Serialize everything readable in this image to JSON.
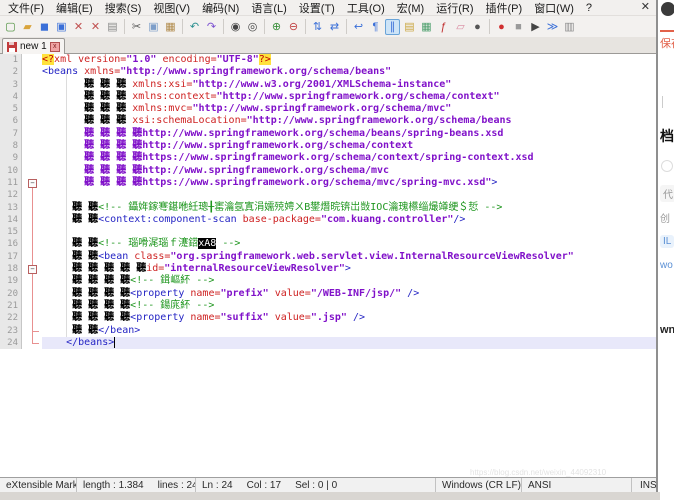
{
  "window": {
    "close_glyph": "✕"
  },
  "menu": {
    "items": [
      "文件(F)",
      "编辑(E)",
      "搜索(S)",
      "视图(V)",
      "编码(N)",
      "语言(L)",
      "设置(T)",
      "工具(O)",
      "宏(M)",
      "运行(R)",
      "插件(P)",
      "窗口(W)",
      "?"
    ]
  },
  "toolbar": {
    "buttons": [
      {
        "name": "new-file-icon",
        "glyph": "▢",
        "color": "#4a8f3a"
      },
      {
        "name": "open-folder-icon",
        "glyph": "▰",
        "color": "#d9a43c"
      },
      {
        "name": "save-icon",
        "glyph": "◼",
        "color": "#3a6fd8"
      },
      {
        "name": "save-all-icon",
        "glyph": "▣",
        "color": "#3a6fd8"
      },
      {
        "name": "close-doc-icon",
        "glyph": "✕",
        "color": "#c05050"
      },
      {
        "name": "close-all-docs-icon",
        "glyph": "✕",
        "color": "#c05050"
      },
      {
        "name": "print-icon",
        "glyph": "▤",
        "color": "#8a8a8a"
      },
      {
        "name": "cut-icon",
        "glyph": "✂",
        "color": "#555555",
        "sep": true
      },
      {
        "name": "copy-icon",
        "glyph": "▣",
        "color": "#7d9ec9"
      },
      {
        "name": "paste-icon",
        "glyph": "▦",
        "color": "#b08a4a"
      },
      {
        "name": "undo-icon",
        "glyph": "↶",
        "color": "#2a8f8f",
        "sep": true
      },
      {
        "name": "redo-icon",
        "glyph": "↷",
        "color": "#7a4fd0"
      },
      {
        "name": "find-icon",
        "glyph": "◉",
        "color": "#444444",
        "sep": true
      },
      {
        "name": "replace-icon",
        "glyph": "◎",
        "color": "#444444"
      },
      {
        "name": "zoom-in-icon",
        "glyph": "⊕",
        "color": "#3a8f3a",
        "sep": true
      },
      {
        "name": "zoom-out-icon",
        "glyph": "⊖",
        "color": "#c04040"
      },
      {
        "name": "sync-vertical-scroll-icon",
        "glyph": "⇅",
        "color": "#3a6fd8",
        "sep": true
      },
      {
        "name": "sync-horizontal-scroll-icon",
        "glyph": "⇄",
        "color": "#3a6fd8"
      },
      {
        "name": "word-wrap-icon",
        "glyph": "↩",
        "color": "#3a6fd8",
        "sep": true
      },
      {
        "name": "show-all-chars-icon",
        "glyph": "¶",
        "color": "#3a6fd8"
      },
      {
        "name": "indent-guide-icon",
        "glyph": "∥",
        "color": "#3a6fd8",
        "pressed": true
      },
      {
        "name": "user-defined-language-icon",
        "glyph": "▤",
        "color": "#c9a53c"
      },
      {
        "name": "doc-map-icon",
        "glyph": "▦",
        "color": "#4a9e6a"
      },
      {
        "name": "function-list-icon",
        "glyph": "ƒ",
        "color": "#c03030"
      },
      {
        "name": "folder-workspace-icon",
        "glyph": "▱",
        "color": "#d98aa0"
      },
      {
        "name": "monitoring-icon",
        "glyph": "●",
        "color": "#555555"
      },
      {
        "name": "macro-record-icon",
        "glyph": "●",
        "color": "#d03030",
        "sep": true
      },
      {
        "name": "macro-stop-icon",
        "glyph": "■",
        "color": "#9a9a9a"
      },
      {
        "name": "macro-play-icon",
        "glyph": "▶",
        "color": "#444444"
      },
      {
        "name": "macro-run-multiple-icon",
        "glyph": "≫",
        "color": "#3a6fd8"
      },
      {
        "name": "macro-save-icon",
        "glyph": "▥",
        "color": "#8a8a8a"
      }
    ]
  },
  "tab": {
    "title": "new 1",
    "close_glyph": "x"
  },
  "editor": {
    "caret_line": 24,
    "fold": {
      "header_lines": [
        11,
        18
      ],
      "tee_lines": [
        23
      ],
      "corner_lines": [
        24
      ],
      "vline_ranges": [
        [
          12,
          17
        ],
        [
          19,
          22
        ]
      ]
    },
    "lines": [
      {
        "n": 1,
        "segs": [
          [
            "decl",
            "<?"
          ],
          [
            "attr",
            "xml version="
          ],
          [
            "str",
            "\"1.0\""
          ],
          [
            "plain",
            " "
          ],
          [
            "attr",
            "encoding="
          ],
          [
            "str",
            "\"UTF-8\""
          ],
          [
            "decl",
            "?>"
          ]
        ]
      },
      {
        "n": 2,
        "segs": [
          [
            "tag",
            "<beans"
          ],
          [
            "plain",
            " "
          ],
          [
            "attr",
            "xmlns="
          ],
          [
            "str",
            "\"http://www.springframework.org/schema/beans\""
          ]
        ]
      },
      {
        "n": 3,
        "segs": [
          [
            "plain",
            "       "
          ],
          [
            "cjk",
            "聽 聽 聽 "
          ],
          [
            "attr",
            "xmlns:xsi="
          ],
          [
            "str",
            "\"http://www.w3.org/2001/XMLSchema-instance\""
          ]
        ]
      },
      {
        "n": 4,
        "segs": [
          [
            "plain",
            "       "
          ],
          [
            "cjk",
            "聽 聽 聽 "
          ],
          [
            "attr",
            "xmlns:context="
          ],
          [
            "str",
            "\"http://www.springframework.org/schema/context\""
          ]
        ]
      },
      {
        "n": 5,
        "segs": [
          [
            "plain",
            "       "
          ],
          [
            "cjk",
            "聽 聽 聽 "
          ],
          [
            "attr",
            "xmlns:mvc="
          ],
          [
            "str",
            "\"http://www.springframework.org/schema/mvc\""
          ]
        ]
      },
      {
        "n": 6,
        "segs": [
          [
            "plain",
            "       "
          ],
          [
            "cjk",
            "聽 聽 聽 "
          ],
          [
            "attr",
            "xsi:schemaLocation="
          ],
          [
            "str",
            "\"http://www.springframework.org/schema/beans"
          ]
        ]
      },
      {
        "n": 7,
        "segs": [
          [
            "plain",
            "       "
          ],
          [
            "cjks",
            "聽 聽 聽 聽"
          ],
          [
            "str",
            "http://www.springframework.org/schema/beans/spring-beans.xsd"
          ]
        ]
      },
      {
        "n": 8,
        "segs": [
          [
            "plain",
            "       "
          ],
          [
            "cjks",
            "聽 聽 聽 聽"
          ],
          [
            "str",
            "http://www.springframework.org/schema/context"
          ]
        ]
      },
      {
        "n": 9,
        "segs": [
          [
            "plain",
            "       "
          ],
          [
            "cjks",
            "聽 聽 聽 聽"
          ],
          [
            "str",
            "https://www.springframework.org/schema/context/spring-context.xsd"
          ]
        ]
      },
      {
        "n": 10,
        "segs": [
          [
            "plain",
            "       "
          ],
          [
            "cjks",
            "聽 聽 聽 聽"
          ],
          [
            "str",
            "http://www.springframework.org/schema/mvc"
          ]
        ]
      },
      {
        "n": 11,
        "segs": [
          [
            "plain",
            "       "
          ],
          [
            "cjks",
            "聽 聽 聽 聽"
          ],
          [
            "str",
            "https://www.springframework.org/schema/mvc/spring-mvc.xsd\""
          ],
          [
            "tag",
            ">"
          ]
        ]
      },
      {
        "n": 12,
        "segs": []
      },
      {
        "n": 13,
        "segs": [
          [
            "plain",
            "     "
          ],
          [
            "cjk",
            "聽 聽"
          ],
          [
            "com",
            "<!-- 鑷姩鎵弿鍖咃紝璁╂寚瀹氬寘涓嬬殑娉ㄨВ鐢熸晥锛岀敱IOC瀹瑰櫒缁熶竴绠＄悊 -->"
          ]
        ]
      },
      {
        "n": 14,
        "segs": [
          [
            "plain",
            "     "
          ],
          [
            "cjk",
            "聽 聽"
          ],
          [
            "tag",
            "<context:component-scan"
          ],
          [
            "plain",
            " "
          ],
          [
            "attr",
            "base-package="
          ],
          [
            "str",
            "\"com.kuang.controller\""
          ],
          [
            "tag",
            "/>"
          ]
        ]
      },
      {
        "n": 15,
        "segs": []
      },
      {
        "n": 16,
        "segs": [
          [
            "plain",
            "     "
          ],
          [
            "cjk",
            "聽 聽"
          ],
          [
            "com",
            "<!-- 瑙嗗浘瑙ｆ瀽鍣"
          ],
          [
            "inv",
            "xA8"
          ],
          [
            "com",
            " -->"
          ]
        ]
      },
      {
        "n": 17,
        "segs": [
          [
            "plain",
            "     "
          ],
          [
            "cjk",
            "聽 聽"
          ],
          [
            "tag",
            "<bean"
          ],
          [
            "plain",
            " "
          ],
          [
            "attr",
            "class="
          ],
          [
            "str",
            "\"org.springframework.web.servlet.view.InternalResourceViewResolver\""
          ]
        ]
      },
      {
        "n": 18,
        "segs": [
          [
            "plain",
            "     "
          ],
          [
            "cjk",
            "聽 聽 聽 聽 聽"
          ],
          [
            "attr",
            "id="
          ],
          [
            "str",
            "\"internalResourceViewResolver\""
          ],
          [
            "tag",
            ">"
          ]
        ]
      },
      {
        "n": 19,
        "segs": [
          [
            "plain",
            "     "
          ],
          [
            "cjk",
            "聽 聽 聽 聽"
          ],
          [
            "com",
            "<!-- 鍓嶇紑 -->"
          ]
        ]
      },
      {
        "n": 20,
        "segs": [
          [
            "plain",
            "     "
          ],
          [
            "cjk",
            "聽 聽 聽 聽"
          ],
          [
            "tag",
            "<property"
          ],
          [
            "plain",
            " "
          ],
          [
            "attr",
            "name="
          ],
          [
            "str",
            "\"prefix\""
          ],
          [
            "plain",
            " "
          ],
          [
            "attr",
            "value="
          ],
          [
            "str",
            "\"/WEB-INF/jsp/\""
          ],
          [
            "plain",
            " "
          ],
          [
            "tag",
            "/>"
          ]
        ]
      },
      {
        "n": 21,
        "segs": [
          [
            "plain",
            "     "
          ],
          [
            "cjk",
            "聽 聽 聽 聽"
          ],
          [
            "com",
            "<!-- 鍚庣紑 -->"
          ]
        ]
      },
      {
        "n": 22,
        "segs": [
          [
            "plain",
            "     "
          ],
          [
            "cjk",
            "聽 聽 聽 聽"
          ],
          [
            "tag",
            "<property"
          ],
          [
            "plain",
            " "
          ],
          [
            "attr",
            "name="
          ],
          [
            "str",
            "\"suffix\""
          ],
          [
            "plain",
            " "
          ],
          [
            "attr",
            "value="
          ],
          [
            "str",
            "\".jsp\""
          ],
          [
            "plain",
            " "
          ],
          [
            "tag",
            "/>"
          ]
        ]
      },
      {
        "n": 23,
        "segs": [
          [
            "plain",
            "     "
          ],
          [
            "cjk",
            "聽 聽"
          ],
          [
            "tag",
            "</bean>"
          ]
        ]
      },
      {
        "n": 24,
        "segs": [
          [
            "plain",
            "    "
          ],
          [
            "tag",
            "</beans>"
          ]
        ]
      }
    ]
  },
  "status": {
    "doctype": "eXtensible Markup La",
    "length": "length : 1.384",
    "lines": "lines : 24",
    "ln": "Ln : 24",
    "col": "Col : 17",
    "sel": "Sel : 0 | 0",
    "eol": "Windows (CR LF)",
    "encoding": "ANSI",
    "mode": "INS"
  },
  "watermark": "https://blog.csdn.net/weixin_44092310",
  "side_page": {
    "save": "保存",
    "heading": "档",
    "chip": "代",
    "chip2": "创",
    "pill": "IL",
    "link": "wo",
    "bold": "wn"
  }
}
